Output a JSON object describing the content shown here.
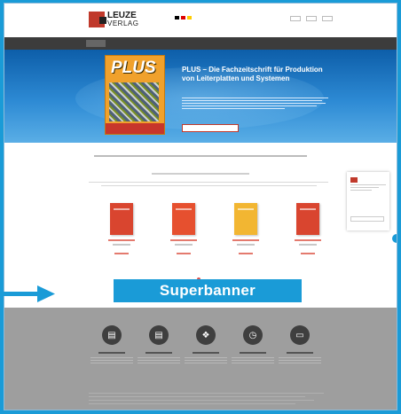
{
  "header": {
    "logo_top": "LEUZE",
    "logo_bottom": "VERLAG"
  },
  "hero": {
    "magazine_title": "PLUS",
    "headline": "PLUS – Die Fachzeitschrift für Produktion von Leiterplatten und Systemen"
  },
  "main": {
    "slider_active_index": 1
  },
  "banner": {
    "label": "Superbanner"
  },
  "footer": {
    "icons": [
      "document-icon",
      "folder-icon",
      "people-icon",
      "clock-icon",
      "monitor-icon"
    ]
  },
  "colors": {
    "accent": "#1a9bd7",
    "brand_red": "#c0392b",
    "nav_bg": "#3c3c3c",
    "footer_bg": "#9e9e9e",
    "hero_blue": "#0d5ea9",
    "magazine_orange": "#f0a12c"
  }
}
